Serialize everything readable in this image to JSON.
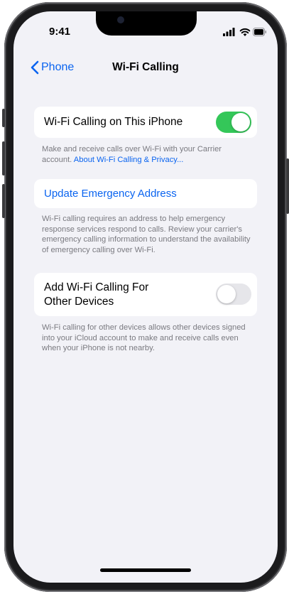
{
  "status_bar": {
    "time": "9:41"
  },
  "nav": {
    "back_label": "Phone",
    "title": "Wi-Fi Calling"
  },
  "wifi_calling": {
    "label": "Wi-Fi Calling on This iPhone",
    "enabled": true,
    "footer_text": "Make and receive calls over Wi-Fi with your Carrier account.",
    "footer_link": "About Wi-Fi Calling & Privacy..."
  },
  "emergency": {
    "link_label": "Update Emergency Address",
    "footer_text": "Wi-Fi calling requires an address to help emergency response services respond to calls. Review your carrier's emergency calling information to understand the availability of emergency calling over Wi-Fi."
  },
  "other_devices": {
    "label_line1": "Add Wi-Fi Calling For",
    "label_line2": "Other Devices",
    "enabled": false,
    "footer_text": "Wi-Fi calling for other devices allows other devices signed into your iCloud account to make and receive calls even when your iPhone is not nearby."
  },
  "colors": {
    "accent_blue": "#0a64f0",
    "toggle_on_green": "#34c759",
    "background": "#f2f2f7"
  }
}
